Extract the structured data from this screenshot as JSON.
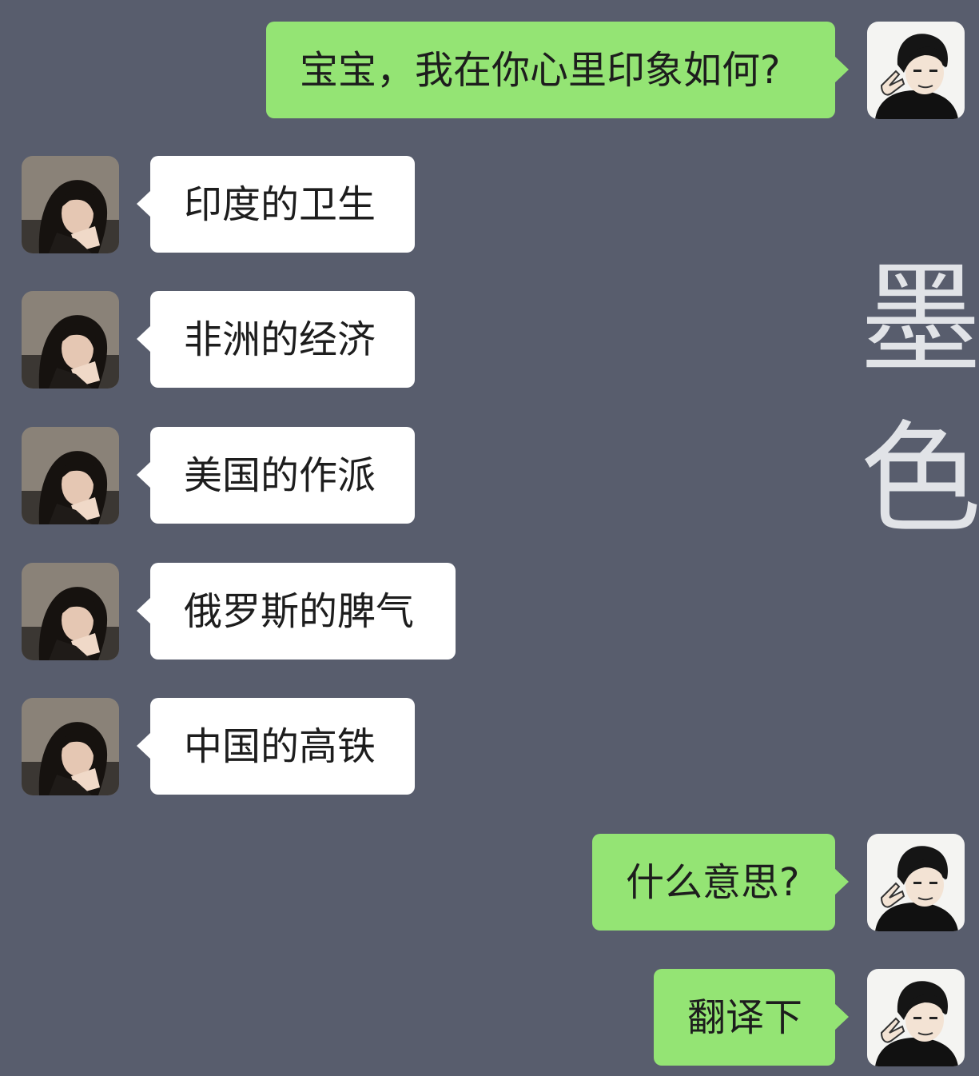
{
  "chat": {
    "messages": [
      {
        "sender": "me",
        "text": "宝宝，我在你心里印象如何?"
      },
      {
        "sender": "her",
        "text": "印度的卫生"
      },
      {
        "sender": "her",
        "text": "非洲的经济"
      },
      {
        "sender": "her",
        "text": "美国的作派"
      },
      {
        "sender": "her",
        "text": "俄罗斯的脾气"
      },
      {
        "sender": "her",
        "text": "中国的高铁"
      },
      {
        "sender": "me",
        "text": "什么意思?"
      },
      {
        "sender": "me",
        "text": "翻译下"
      }
    ]
  },
  "watermark": {
    "char_1": "墨",
    "char_2": "色"
  },
  "colors": {
    "background": "#585d6d",
    "outgoing_bubble": "#94e474",
    "incoming_bubble": "#ffffff"
  },
  "icons": {
    "my_avatar": "cartoon-man-avatar",
    "her_avatar": "woman-photo-avatar"
  }
}
